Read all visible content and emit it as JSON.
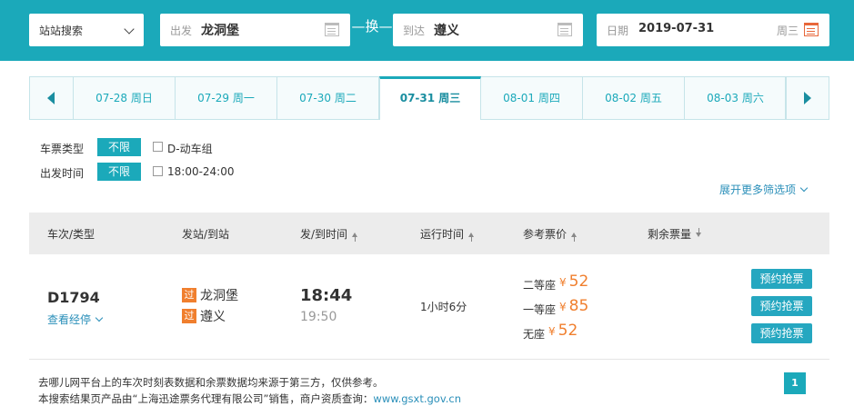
{
  "search": {
    "mode": "站站搜索",
    "from_label": "出发",
    "from_city": "龙洞堡",
    "swap_label": "换",
    "to_label": "到达",
    "to_city": "遵义",
    "date_label": "日期",
    "date_value": "2019-07-31",
    "weekday": "周三"
  },
  "date_tabs": [
    {
      "label": "07-28 周日"
    },
    {
      "label": "07-29 周一"
    },
    {
      "label": "07-30 周二"
    },
    {
      "label": "07-31 周三",
      "active": true
    },
    {
      "label": "08-01 周四"
    },
    {
      "label": "08-02 周五"
    },
    {
      "label": "08-03 周六"
    }
  ],
  "filters": {
    "ticket_type_label": "车票类型",
    "ticket_type_tag": "不限",
    "ticket_type_option": "D-动车组",
    "depart_time_label": "出发时间",
    "depart_time_tag": "不限",
    "depart_time_option": "18:00-24:00",
    "more_label": "展开更多筛选项"
  },
  "table_headers": {
    "train": "车次/类型",
    "stations": "发站/到站",
    "times": "发/到时间",
    "duration": "运行时间",
    "price": "参考票价",
    "remaining": "剩余票量"
  },
  "train": {
    "number": "D1794",
    "stops_link": "查看经停",
    "from_badge": "过",
    "from_station": "龙洞堡",
    "to_badge": "过",
    "to_station": "遵义",
    "depart_time": "18:44",
    "arrive_time": "19:50",
    "duration": "1小时6分",
    "prices": [
      {
        "seat": "二等座",
        "currency": "¥",
        "amount": "52",
        "action": "预约抢票"
      },
      {
        "seat": "一等座",
        "currency": "¥",
        "amount": "85",
        "action": "预约抢票"
      },
      {
        "seat": "无座",
        "currency": "¥",
        "amount": "52",
        "action": "预约抢票"
      }
    ]
  },
  "footer": {
    "line1": "去哪儿网平台上的车次时刻表数据和余票数据均来源于第三方，仅供参考。",
    "line2_prefix": "本搜索结果页产品由“上海迅途票务代理有限公司”销售，商户资质查询：",
    "line2_link": "www.gsxt.gov.cn",
    "page": "1"
  },
  "colors": {
    "brand_teal": "#1ba9ba",
    "price_orange": "#f07f2e",
    "link_blue": "#2a8fb9"
  }
}
